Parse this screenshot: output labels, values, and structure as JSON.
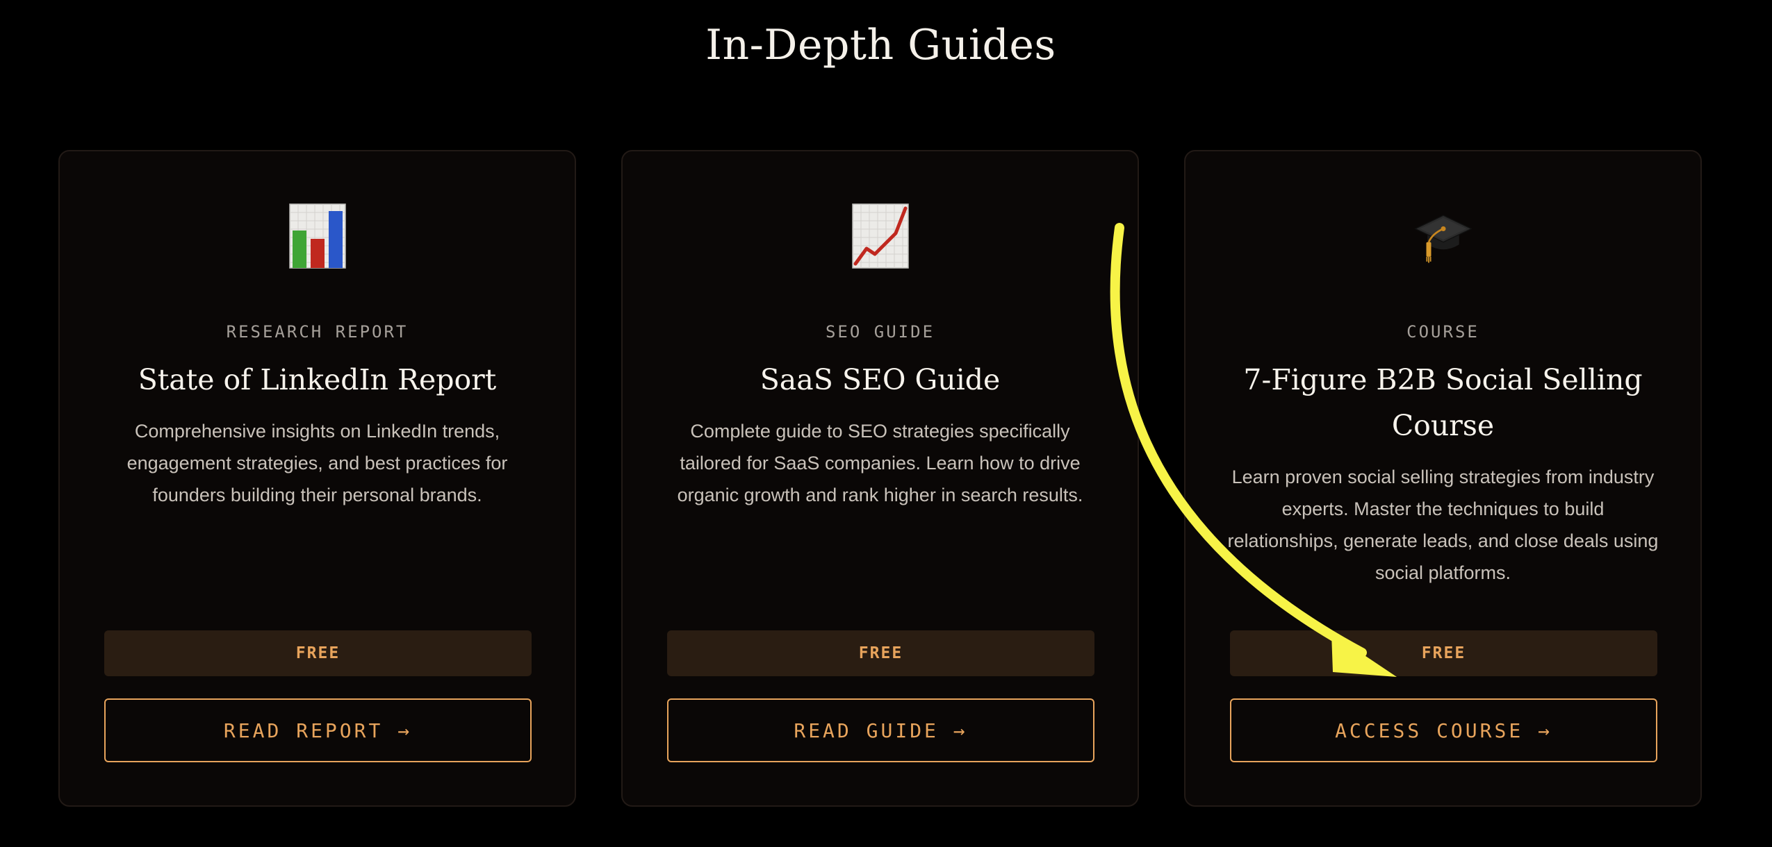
{
  "page": {
    "title": "In-Depth Guides"
  },
  "cards": [
    {
      "icon": "bar-chart-icon",
      "category": "RESEARCH REPORT",
      "title": "State of LinkedIn Report",
      "description": "Comprehensive insights on LinkedIn trends, engagement strategies, and best practices for founders building their personal brands.",
      "price": "FREE",
      "cta": "READ REPORT →"
    },
    {
      "icon": "trending-up-chart-icon",
      "category": "SEO GUIDE",
      "title": "SaaS SEO Guide",
      "description": "Complete guide to SEO strategies specifically tailored for SaaS companies. Learn how to drive organic growth and rank higher in search results.",
      "price": "FREE",
      "cta": "READ GUIDE →"
    },
    {
      "icon": "graduation-cap-icon",
      "category": "COURSE",
      "title": "7-Figure B2B Social Selling Course",
      "description": "Learn proven social selling strategies from industry experts. Master the techniques to build relationships, generate leads, and close deals using social platforms.",
      "price": "FREE",
      "cta": "ACCESS COURSE →"
    }
  ],
  "colors": {
    "accent": "#e8a45c",
    "badge_bg": "#2a1d12",
    "card_bg": "#0a0706",
    "annotation_arrow": "#f7f347"
  }
}
